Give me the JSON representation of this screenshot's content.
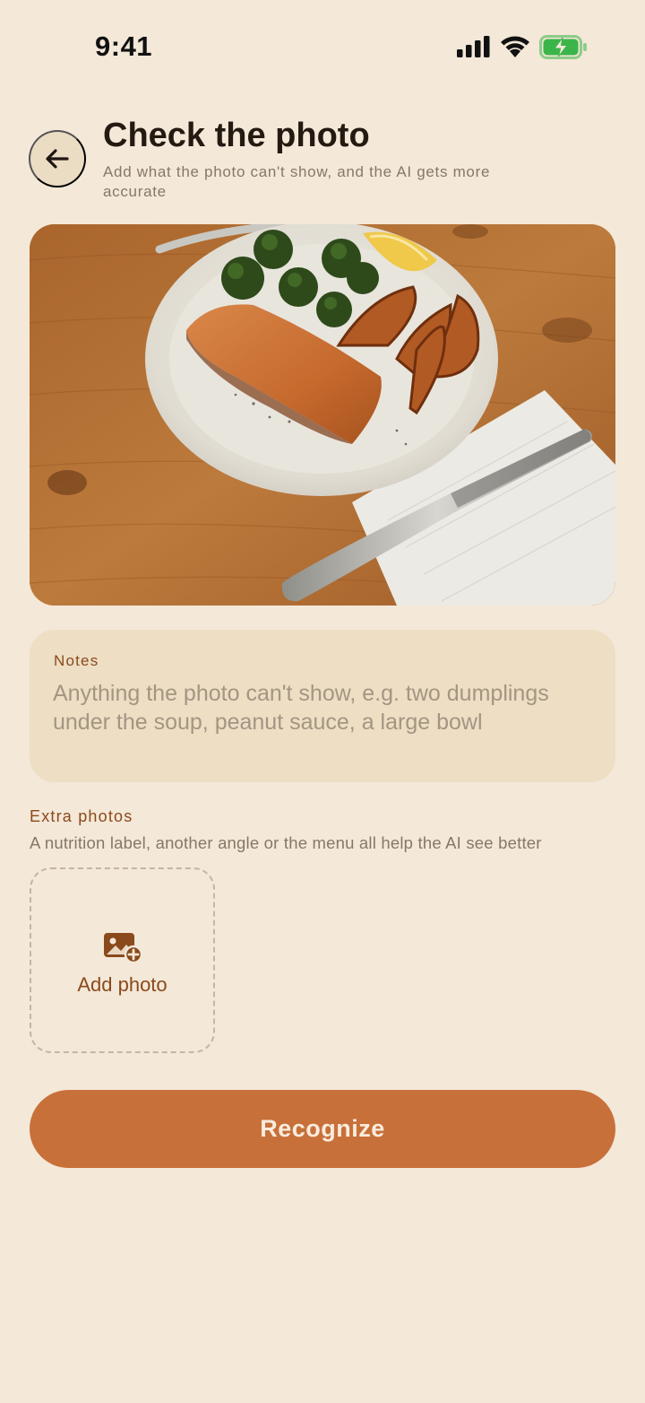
{
  "status_bar": {
    "time": "9:41",
    "icons": [
      "signal-icon",
      "wifi-icon",
      "battery-charging-icon"
    ]
  },
  "header": {
    "back_icon": "arrow-left-icon",
    "title": "Check the photo",
    "subtitle": "Add what the photo can't show, and the AI gets more accurate"
  },
  "photo": {
    "description_icon": "food-photo"
  },
  "notes": {
    "label": "Notes",
    "value": "",
    "placeholder": "Anything the photo can't show, e.g. two dumplings under the soup, peanut sauce, a large bowl"
  },
  "extra_photos": {
    "title": "Extra photos",
    "description": "A nutrition label, another angle or the menu all help the AI see better",
    "add_label": "Add photo",
    "add_icon": "add-image-icon"
  },
  "actions": {
    "recognize_label": "Recognize"
  },
  "colors": {
    "background": "#F4E8D8",
    "accent": "#C8703A",
    "label_brown": "#8A4A1C",
    "card": "#EDDEC4"
  }
}
